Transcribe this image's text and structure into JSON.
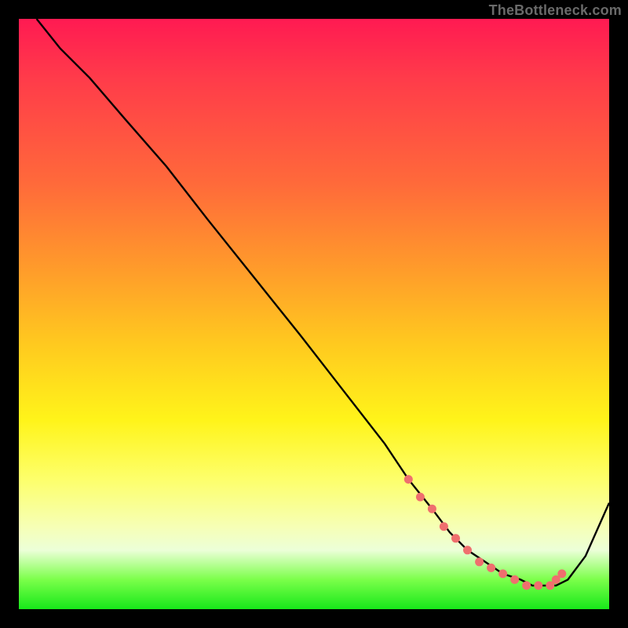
{
  "watermark": "TheBottleneck.com",
  "chart_data": {
    "type": "line",
    "title": "",
    "xlabel": "",
    "ylabel": "",
    "xlim": [
      0,
      100
    ],
    "ylim": [
      0,
      100
    ],
    "grid": false,
    "series": [
      {
        "name": "curve",
        "color": "#000000",
        "x": [
          3,
          7,
          12,
          18,
          25,
          32,
          40,
          48,
          55,
          62,
          66,
          70,
          73,
          76,
          79,
          82,
          85,
          87,
          89,
          91,
          93,
          96,
          100
        ],
        "y": [
          100,
          95,
          90,
          83,
          75,
          66,
          56,
          46,
          37,
          28,
          22,
          17,
          13,
          10,
          8,
          6,
          5,
          4,
          4,
          4,
          5,
          9,
          18
        ]
      }
    ],
    "markers": [
      {
        "name": "highlight-dots",
        "color": "#ef6f6e",
        "x": [
          66,
          68,
          70,
          72,
          74,
          76,
          78,
          80,
          82,
          84,
          86,
          88,
          90,
          91,
          92
        ],
        "y": [
          22,
          19,
          17,
          14,
          12,
          10,
          8,
          7,
          6,
          5,
          4,
          4,
          4,
          5,
          6
        ]
      }
    ]
  }
}
